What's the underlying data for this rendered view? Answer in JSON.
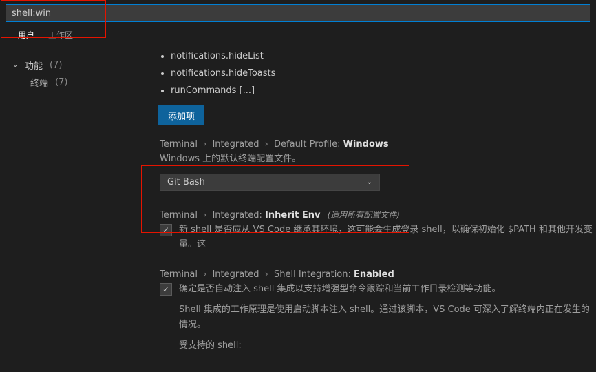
{
  "search": {
    "value": "shell:win"
  },
  "tabs": {
    "user": "用户",
    "workspace": "工作区"
  },
  "sidebar": {
    "group_label": "功能",
    "group_count": "(7)",
    "child_label": "终端",
    "child_count": "(7)"
  },
  "bullets": {
    "b0": "notifications.hideList",
    "b1": "notifications.hideToasts",
    "b2": "runCommands [...]"
  },
  "buttons": {
    "add_item": "添加项"
  },
  "s1": {
    "c0": "Terminal",
    "c1": "Integrated",
    "c2": "Default Profile:",
    "bold": "Windows",
    "desc": "Windows 上的默认终端配置文件。",
    "dropdown_value": "Git Bash"
  },
  "s2": {
    "c0": "Terminal",
    "c1": "Integrated:",
    "bold": "Inherit Env",
    "scope": "(适用所有配置文件)",
    "desc": "新 shell 是否应从 VS Code 继承其环境，这可能会生成登录 shell，以确保初始化 $PATH 和其他开发变量。这"
  },
  "s3": {
    "c0": "Terminal",
    "c1": "Integrated",
    "c2": "Shell Integration:",
    "bold": "Enabled",
    "desc": "确定是否自动注入 shell 集成以支持增强型命令跟踪和当前工作目录检测等功能。",
    "sub1": "Shell 集成的工作原理是使用启动脚本注入 shell。通过该脚本，VS Code 可深入了解终端内正在发生的情况。",
    "sub2": "受支持的 shell:"
  },
  "sep": "›"
}
